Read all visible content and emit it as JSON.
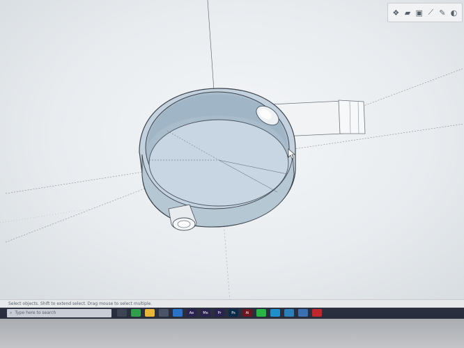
{
  "toolbar": {
    "buttons": [
      {
        "name": "component-icon",
        "glyph": "❖"
      },
      {
        "name": "open-folder-icon",
        "glyph": "▰"
      },
      {
        "name": "save-icon",
        "glyph": "▣"
      },
      {
        "name": "ruler-icon",
        "glyph": "⟋"
      },
      {
        "name": "tape-measure-icon",
        "glyph": "✎"
      },
      {
        "name": "paint-bucket-icon",
        "glyph": "◐"
      }
    ]
  },
  "status": {
    "hint": "Select objects. Shift to extend select. Drag mouse to select multiple."
  },
  "taskbar": {
    "search_placeholder": "Type here to search",
    "apps": [
      {
        "name": "task-view-icon",
        "label": "",
        "color": "#3d4452"
      },
      {
        "name": "chrome-icon",
        "label": "",
        "color": "#2f9f4b"
      },
      {
        "name": "file-explorer-icon",
        "label": "",
        "color": "#e9b638"
      },
      {
        "name": "store-icon",
        "label": "",
        "color": "#4a5466"
      },
      {
        "name": "mail-icon",
        "label": "",
        "color": "#2b73c9"
      },
      {
        "name": "after-effects-icon",
        "label": "Ae",
        "color": "#2a2350"
      },
      {
        "name": "media-encoder-icon",
        "label": "Me",
        "color": "#2a2350"
      },
      {
        "name": "premiere-icon",
        "label": "Pr",
        "color": "#2a2350"
      },
      {
        "name": "photoshop-icon",
        "label": "Ps",
        "color": "#0c2a4a"
      },
      {
        "name": "acrobat-icon",
        "label": "Ai",
        "color": "#6b1620"
      },
      {
        "name": "whatsapp-icon",
        "label": "",
        "color": "#29b446"
      },
      {
        "name": "edge-icon",
        "label": "",
        "color": "#1f8fcc"
      },
      {
        "name": "teams-icon",
        "label": "",
        "color": "#2c7fb8"
      },
      {
        "name": "photos-icon",
        "label": "",
        "color": "#3b6fb0"
      },
      {
        "name": "sketchup-icon",
        "label": "",
        "color": "#c2262d"
      }
    ]
  }
}
